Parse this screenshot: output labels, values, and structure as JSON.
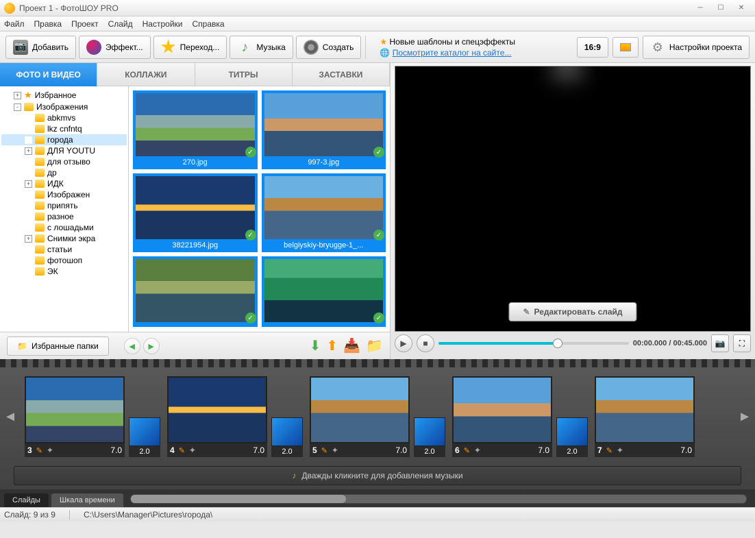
{
  "window": {
    "title": "Проект 1 - ФотоШОУ PRO"
  },
  "menu": [
    "Файл",
    "Правка",
    "Проект",
    "Слайд",
    "Настройки",
    "Справка"
  ],
  "toolbar": {
    "add": "Добавить",
    "effects": "Эффект...",
    "transitions": "Переход...",
    "music": "Музыка",
    "create": "Создать",
    "info1": "Новые шаблоны и спецэффекты",
    "info2": "Посмотрите каталог на сайте...",
    "ratio": "16:9",
    "settings": "Настройки проекта"
  },
  "categoryTabs": [
    "ФОТО И ВИДЕО",
    "КОЛЛАЖИ",
    "ТИТРЫ",
    "ЗАСТАВКИ"
  ],
  "tree": [
    {
      "label": "Избранное",
      "indent": 1,
      "exp": "+",
      "fav": true
    },
    {
      "label": "Изображения",
      "indent": 1,
      "exp": "-"
    },
    {
      "label": "abkmvs",
      "indent": 2,
      "exp": ""
    },
    {
      "label": "lkz cnfntq",
      "indent": 2,
      "exp": ""
    },
    {
      "label": "города",
      "indent": 2,
      "exp": "",
      "selected": true
    },
    {
      "label": "ДЛЯ YOUTU",
      "indent": 2,
      "exp": "+"
    },
    {
      "label": "для отзыво",
      "indent": 2,
      "exp": ""
    },
    {
      "label": "др",
      "indent": 2,
      "exp": ""
    },
    {
      "label": "ИДК",
      "indent": 2,
      "exp": "+"
    },
    {
      "label": "Изображен",
      "indent": 2,
      "exp": ""
    },
    {
      "label": "припять",
      "indent": 2,
      "exp": ""
    },
    {
      "label": "разное",
      "indent": 2,
      "exp": ""
    },
    {
      "label": "с лошадьми",
      "indent": 2,
      "exp": ""
    },
    {
      "label": "Снимки экра",
      "indent": 2,
      "exp": "+"
    },
    {
      "label": "статьи",
      "indent": 2,
      "exp": ""
    },
    {
      "label": "фотошоп",
      "indent": 2,
      "exp": ""
    },
    {
      "label": "ЭК",
      "indent": 2,
      "exp": ""
    }
  ],
  "thumbs": [
    {
      "label": "270.jpg",
      "scene": "a"
    },
    {
      "label": "997-3.jpg",
      "scene": "b"
    },
    {
      "label": "38221954.jpg",
      "scene": "c"
    },
    {
      "label": "belgiyskiy-bryugge-1_...",
      "scene": "d"
    },
    {
      "label": "",
      "scene": "f"
    },
    {
      "label": "",
      "scene": "e"
    }
  ],
  "favButton": "Избранные папки",
  "editSlide": "Редактировать слайд",
  "time": "00:00.000 / 00:45.000",
  "timeline": {
    "slides": [
      {
        "num": "3",
        "dur": "7.0",
        "scene": "a"
      },
      {
        "num": "4",
        "dur": "7.0",
        "scene": "c"
      },
      {
        "num": "5",
        "dur": "7.0",
        "scene": "d"
      },
      {
        "num": "6",
        "dur": "7.0",
        "scene": "b"
      },
      {
        "num": "7",
        "dur": "7.0",
        "scene": "d"
      }
    ],
    "transDur": "2.0",
    "musicHint": "Дважды кликните для добавления музыки",
    "tabs": [
      "Слайды",
      "Шкала времени"
    ]
  },
  "status": {
    "slide": "Слайд: 9 из 9",
    "path": "C:\\Users\\Manager\\Pictures\\города\\"
  }
}
